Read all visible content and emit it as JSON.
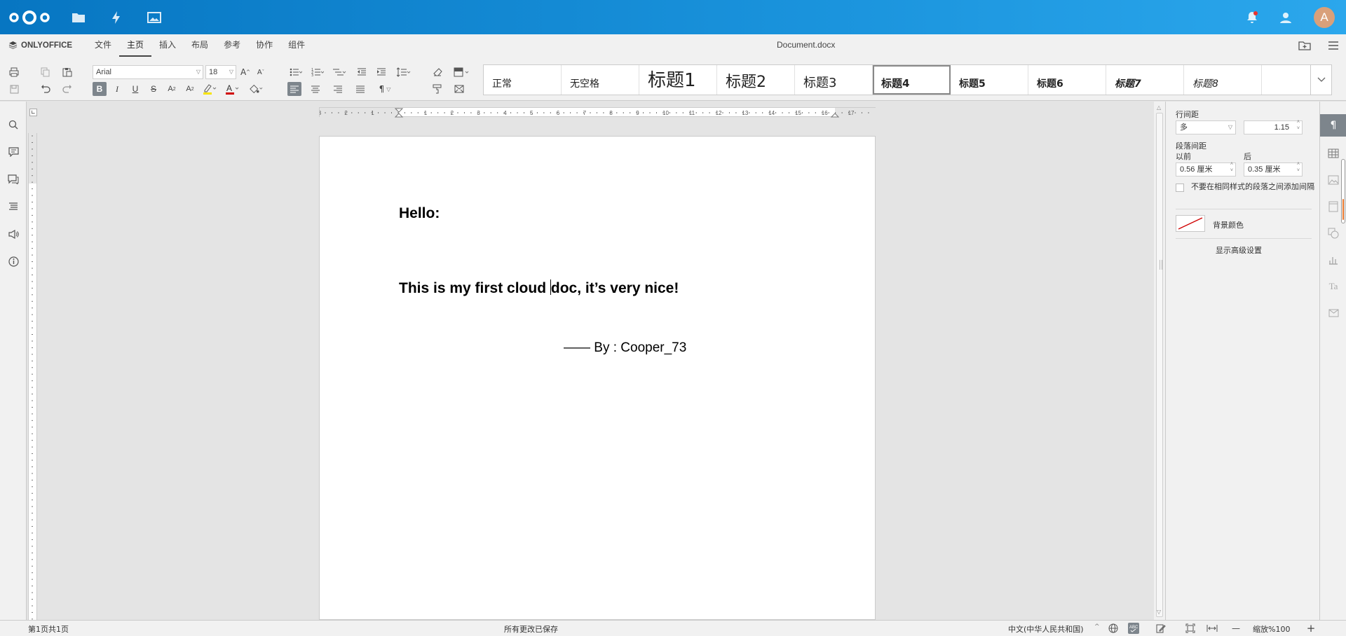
{
  "topbar": {
    "icons": [
      "nextcloud-logo",
      "files-icon",
      "activity-icon",
      "photos-icon",
      "notifications-icon",
      "contacts-icon"
    ],
    "avatar_letter": "A",
    "accent": "#0082c9"
  },
  "menubar": {
    "brand": "ONLYOFFICE",
    "tabs": [
      "文件",
      "主页",
      "插入",
      "布局",
      "参考",
      "协作",
      "组件"
    ],
    "active_tab": "主页",
    "document_title": "Document.docx"
  },
  "toolbar": {
    "font_name": "Arial",
    "font_size": "18",
    "styles": [
      "正常",
      "无空格",
      "标题1",
      "标题2",
      "标题3",
      "标题4",
      "标题5",
      "标题6",
      "标题7",
      "标题8"
    ],
    "active_style": "标题4"
  },
  "document": {
    "line1": "Hello:",
    "line2_before_caret": "This is my first cloud ",
    "line2_after_caret": "doc, it’s very nice!",
    "line3": "—— By : Cooper_73"
  },
  "paragraph_settings": {
    "line_spacing_label": "行间距",
    "line_spacing_mode": "多",
    "line_spacing_value": "1.15",
    "paragraph_spacing_label": "段落间距",
    "before_label": "以前",
    "after_label": "后",
    "before_value": "0.56 厘米",
    "after_value": "0.35 厘米",
    "no_space_same_style": "不要在相同样式的段落之间添加间隔",
    "background_color_label": "背景颜色",
    "advanced_settings": "显示高级设置"
  },
  "statusbar": {
    "page_info": "第1页共1页",
    "save_status": "所有更改已保存",
    "language": "中文(中华人民共和国)",
    "zoom": "缩放%100"
  }
}
